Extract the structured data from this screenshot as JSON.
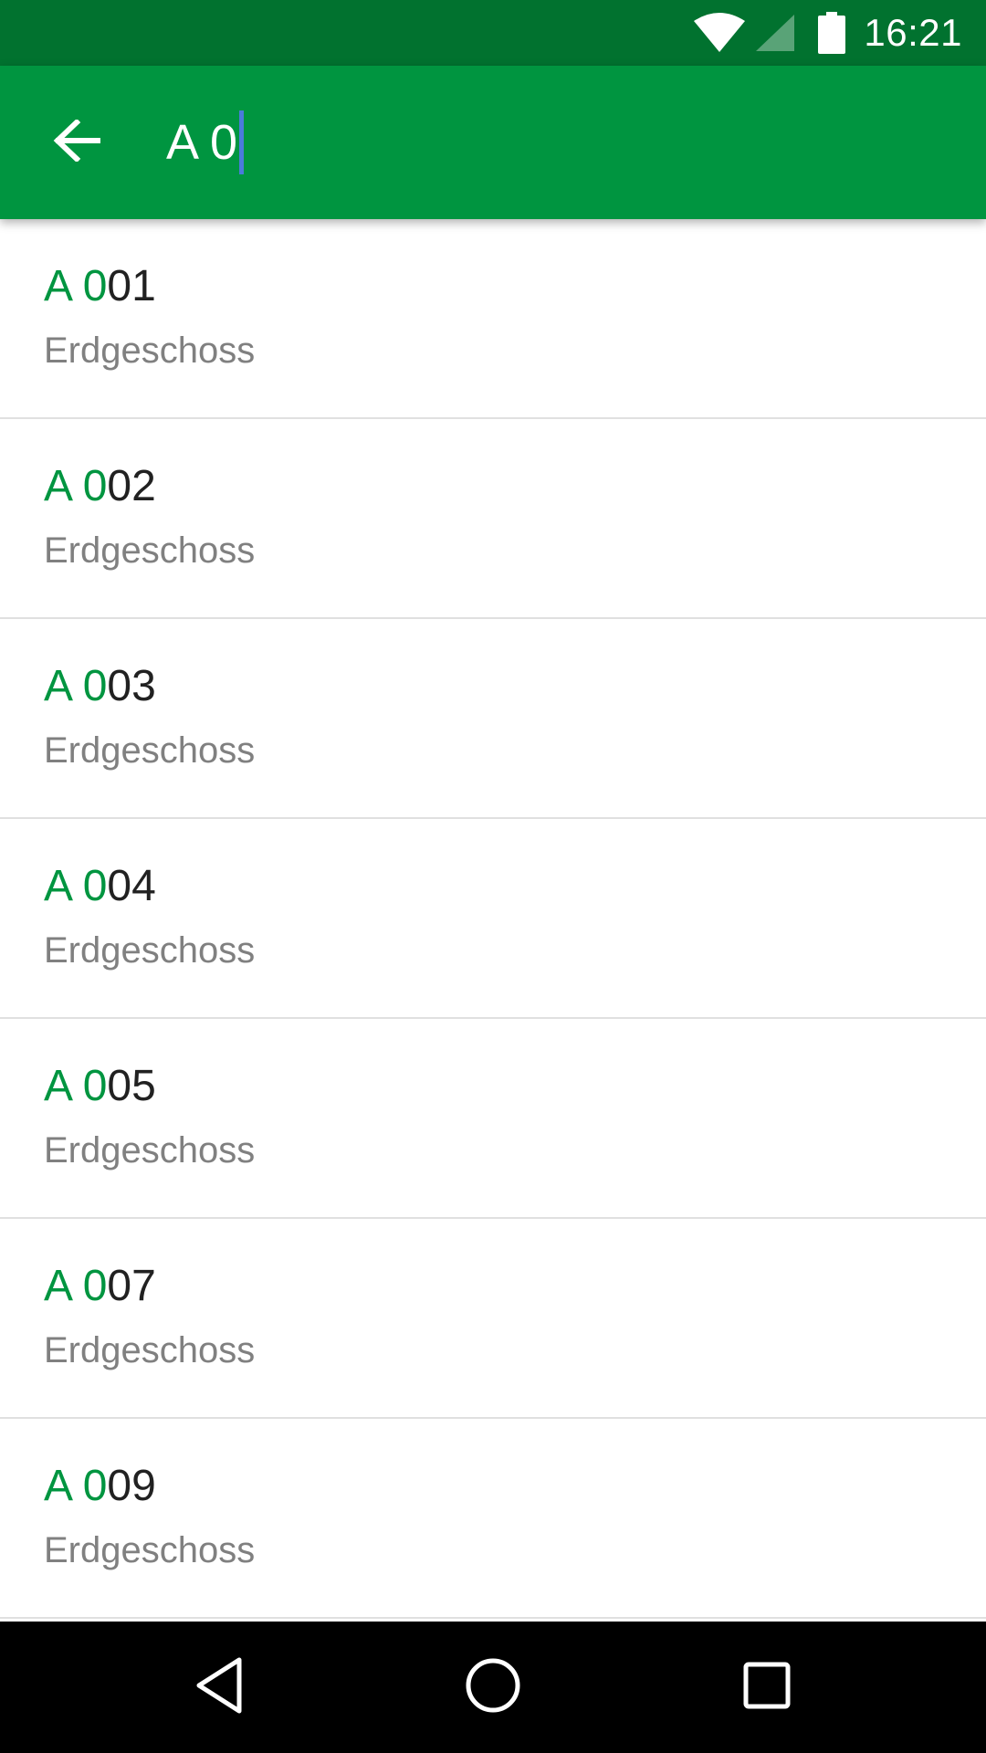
{
  "status_bar": {
    "time": "16:21",
    "icons": [
      "wifi-icon",
      "cell-signal-icon",
      "battery-icon"
    ]
  },
  "toolbar": {
    "back_icon": "arrow-left-icon",
    "search_value": "A 0",
    "background_color": "#009540"
  },
  "results": [
    {
      "match": "A 0",
      "rest": "01",
      "subtitle": "Erdgeschoss"
    },
    {
      "match": "A 0",
      "rest": "02",
      "subtitle": "Erdgeschoss"
    },
    {
      "match": "A 0",
      "rest": "03",
      "subtitle": "Erdgeschoss"
    },
    {
      "match": "A 0",
      "rest": "04",
      "subtitle": "Erdgeschoss"
    },
    {
      "match": "A 0",
      "rest": "05",
      "subtitle": "Erdgeschoss"
    },
    {
      "match": "A 0",
      "rest": "07",
      "subtitle": "Erdgeschoss"
    },
    {
      "match": "A 0",
      "rest": "09",
      "subtitle": "Erdgeschoss"
    }
  ],
  "nav_bar": {
    "icons": [
      "back-triangle-icon",
      "home-circle-icon",
      "recents-square-icon"
    ]
  },
  "colors": {
    "status_bar": "#01722F",
    "toolbar": "#009540",
    "match_text": "#009540",
    "caret": "#4A7BDB",
    "subtitle_text": "#808080",
    "divider": "#E0E0E0"
  }
}
